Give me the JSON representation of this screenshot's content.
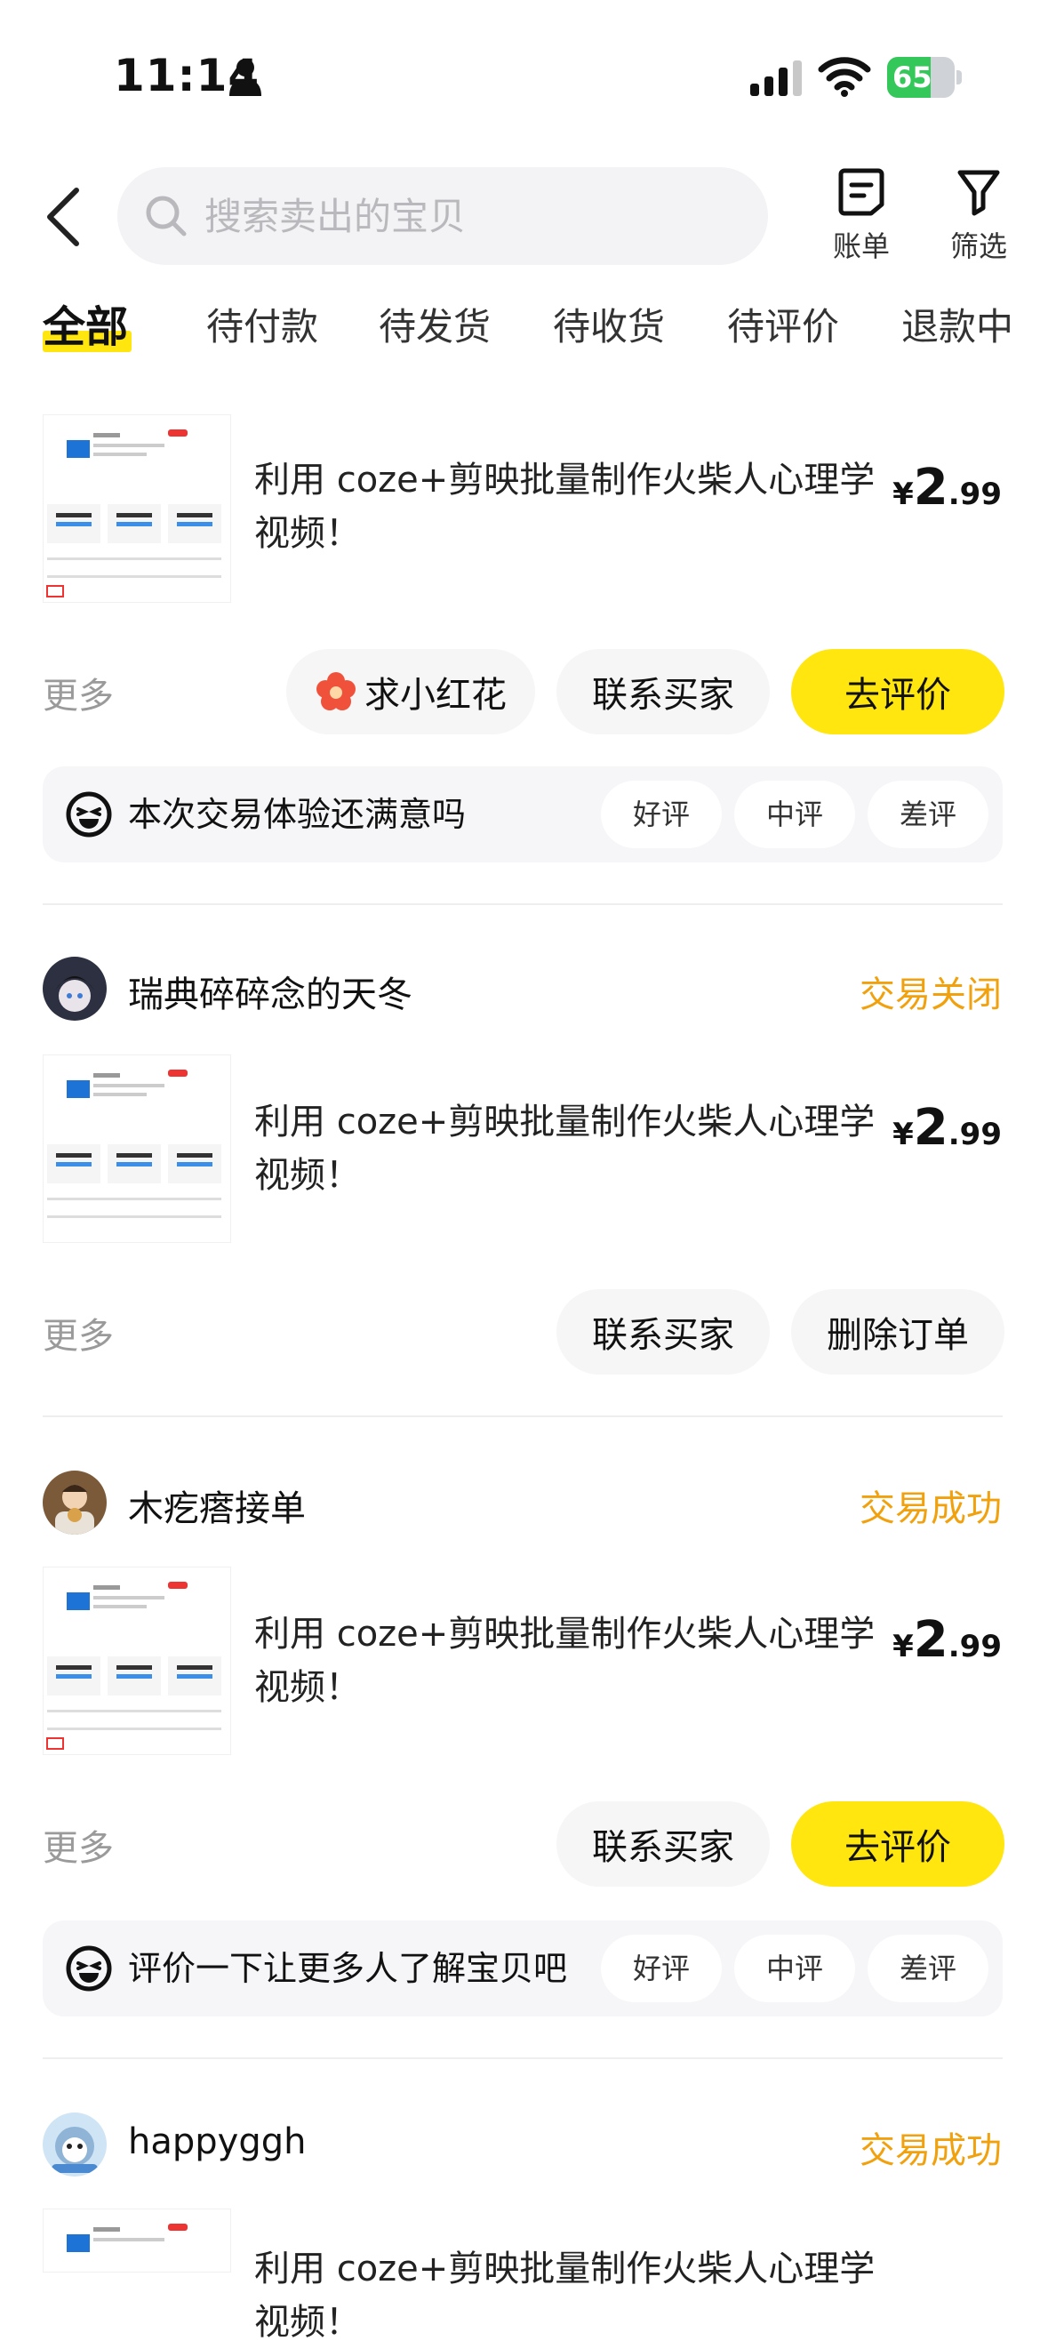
{
  "status_bar": {
    "time": "11:14",
    "battery": "65",
    "battery_level": 0.65
  },
  "header": {
    "search_placeholder": "搜索卖出的宝贝",
    "bill_label": "账单",
    "filter_label": "筛选"
  },
  "tabs": [
    {
      "label": "全部",
      "active": true
    },
    {
      "label": "待付款"
    },
    {
      "label": "待发货"
    },
    {
      "label": "待收货"
    },
    {
      "label": "待评价"
    },
    {
      "label": "退款中"
    }
  ],
  "orders": [
    {
      "title": "利用 coze+剪映批量制作火柴人心理学视频！",
      "price_currency": "¥",
      "price_int": "2",
      "price_dec": ".99",
      "more": "更多",
      "btn_flower": "求小红花",
      "btn_contact": "联系买家",
      "btn_review": "去评价",
      "review_prompt": "本次交易体验还满意吗",
      "review_good": "好评",
      "review_mid": "中评",
      "review_bad": "差评"
    },
    {
      "shop": "瑞典碎碎念的天冬",
      "status": "交易关闭",
      "title": "利用 coze+剪映批量制作火柴人心理学视频！",
      "price_currency": "¥",
      "price_int": "2",
      "price_dec": ".99",
      "more": "更多",
      "btn_contact": "联系买家",
      "btn_delete": "删除订单"
    },
    {
      "shop": "木疙瘩接单",
      "status": "交易成功",
      "title": "利用 coze+剪映批量制作火柴人心理学视频！",
      "price_currency": "¥",
      "price_int": "2",
      "price_dec": ".99",
      "more": "更多",
      "btn_contact": "联系买家",
      "btn_review": "去评价",
      "review_prompt": "评价一下让更多人了解宝贝吧",
      "review_good": "好评",
      "review_mid": "中评",
      "review_bad": "差评"
    },
    {
      "shop": "happyggh",
      "status": "交易成功",
      "title": "利用 coze+剪映批量制作火柴人心理学视频！"
    }
  ],
  "colors": {
    "accent_yellow": "#ffe60f",
    "status_orange": "#f0a10d",
    "battery_green": "#34c759"
  }
}
